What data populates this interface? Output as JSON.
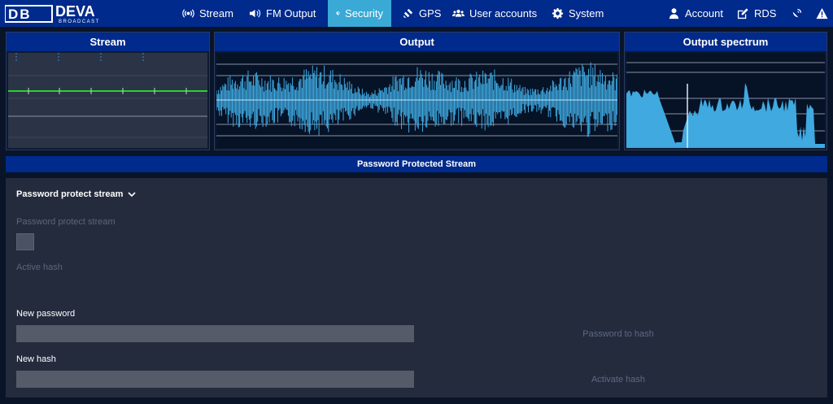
{
  "brand": {
    "name": "DEVA",
    "sub": "BROADCAST",
    "mark": "DB"
  },
  "nav": [
    {
      "label": "Stream"
    },
    {
      "label": "FM Output"
    },
    {
      "label": "Security"
    },
    {
      "label": "GPS"
    },
    {
      "label": "User accounts"
    },
    {
      "label": "System"
    },
    {
      "label": "Account"
    },
    {
      "label": "RDS"
    }
  ],
  "panels": {
    "stream": "Stream",
    "output": "Output",
    "spectrum": "Output spectrum"
  },
  "banner": "Password Protected Stream",
  "form": {
    "section_title": "Password protect stream",
    "protect_label": "Password protect stream",
    "active_hash_label": "Active hash",
    "new_password_label": "New password",
    "new_hash_label": "New hash",
    "password_to_hash": "Password to hash",
    "activate_hash": "Activate hash"
  },
  "colors": {
    "accent": "#002a8c",
    "active_tab": "#3aa9d6",
    "waveform": "#3fa9e0",
    "stream_level": "#2bd12b"
  }
}
